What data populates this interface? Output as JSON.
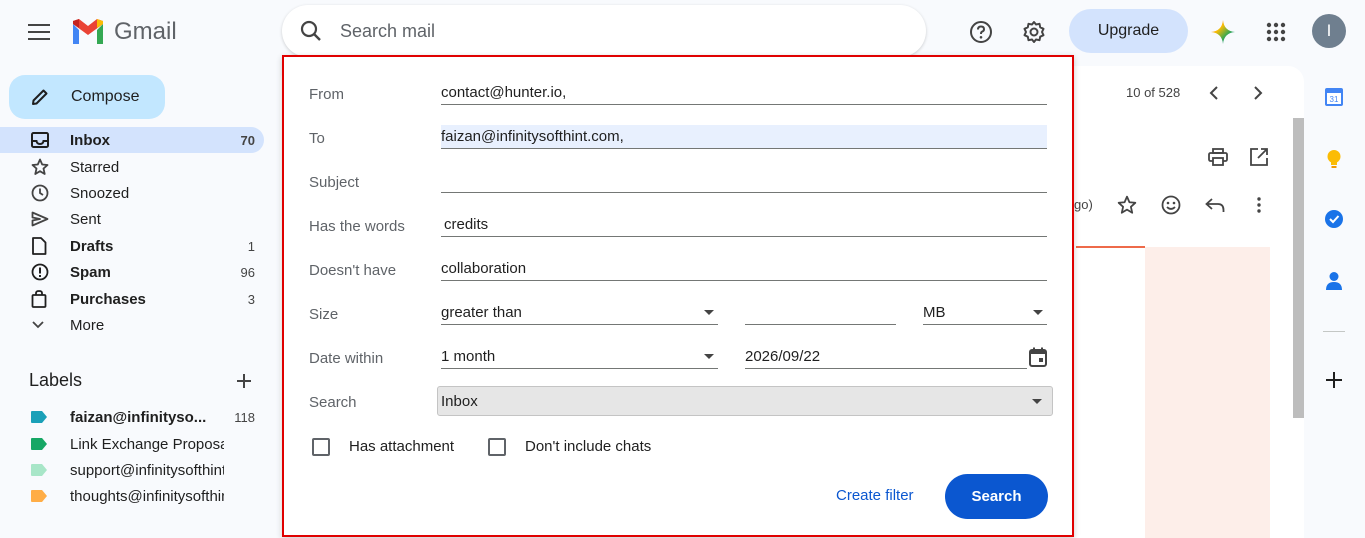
{
  "app": {
    "name": "Gmail"
  },
  "header": {
    "search_placeholder": "Search mail",
    "upgrade_label": "Upgrade",
    "avatar_initial": "I",
    "icons": [
      "menu-icon",
      "search-icon",
      "help-icon",
      "gear-icon",
      "gemini-icon",
      "apps-grid-icon"
    ]
  },
  "sidebar": {
    "compose_label": "Compose",
    "items": [
      {
        "label": "Inbox",
        "count": "70",
        "icon": "inbox-icon",
        "bold": true,
        "active": true
      },
      {
        "label": "Starred",
        "count": "",
        "icon": "star-icon"
      },
      {
        "label": "Snoozed",
        "count": "",
        "icon": "clock-icon"
      },
      {
        "label": "Sent",
        "count": "",
        "icon": "send-icon"
      },
      {
        "label": "Drafts",
        "count": "1",
        "icon": "draft-icon",
        "bold": true
      },
      {
        "label": "Spam",
        "count": "96",
        "icon": "spam-icon",
        "bold": true
      },
      {
        "label": "Purchases",
        "count": "3",
        "icon": "bag-icon",
        "bold": true
      },
      {
        "label": "More",
        "count": "",
        "icon": "chevron-down-icon"
      }
    ],
    "labels_title": "Labels",
    "labels": [
      {
        "label": "faizan@infinityso...",
        "count": "118",
        "color": "#1aa0b8",
        "bold": true
      },
      {
        "label": "Link Exchange Proposal",
        "count": "",
        "color": "#16a765"
      },
      {
        "label": "support@infinitysofthint....",
        "count": "",
        "color": "#a8e6c8"
      },
      {
        "label": "thoughts@infinitysofthin...",
        "count": "",
        "color": "#ffad46"
      }
    ]
  },
  "mail_view": {
    "pager": "10 of 528",
    "ago_fragment": "go)"
  },
  "advanced_search": {
    "from_label": "From",
    "from_value": "contact@hunter.io,",
    "to_label": "To",
    "to_value": "faizan@infinitysofthint.com,",
    "subject_label": "Subject",
    "subject_value": "",
    "has_words_label": "Has the words",
    "has_words_value": "credits",
    "doesnt_have_label": "Doesn't have",
    "doesnt_have_value": "collaboration",
    "size_label": "Size",
    "size_operator": "greater than",
    "size_value": "",
    "size_unit": "MB",
    "date_within_label": "Date within",
    "date_within_value": "1 month",
    "date_value": "2026/09/22",
    "search_label": "Search",
    "search_scope": "Inbox",
    "has_attachment_label": "Has attachment",
    "no_chats_label": "Don't include chats",
    "create_filter_label": "Create filter",
    "search_button_label": "Search"
  },
  "colors": {
    "accent": "#0b57d0",
    "compose_bg": "#c2e7ff",
    "active_nav": "#d3e3fd",
    "highlight_border": "#e00000"
  }
}
